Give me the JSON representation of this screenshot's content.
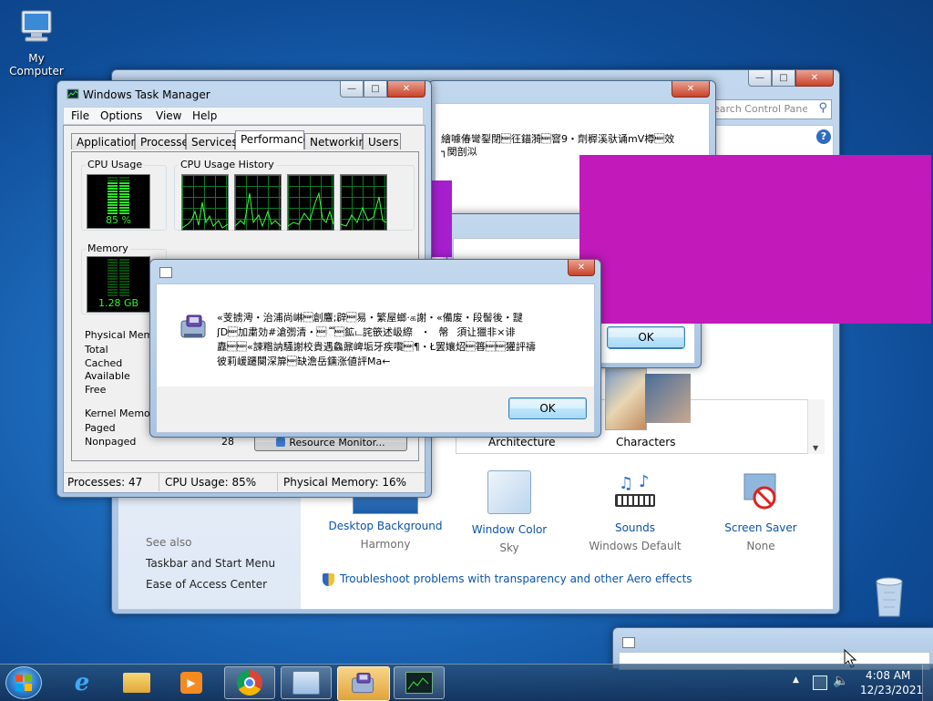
{
  "desktop": {
    "my_computer": "My Computer",
    "recycle_bin": "Recycle Bin"
  },
  "personalization": {
    "search_placeholder": "Search Control Panel",
    "themes": [
      "Architecture",
      "Characters"
    ],
    "items": [
      {
        "label": "Desktop Background",
        "value": "Harmony"
      },
      {
        "label": "Window Color",
        "value": "Sky"
      },
      {
        "label": "Sounds",
        "value": "Windows Default"
      },
      {
        "label": "Screen Saver",
        "value": "None"
      }
    ],
    "see_also": "See also",
    "links": [
      "Taskbar and Start Menu",
      "Ease of Access Center"
    ],
    "troubleshoot": "Troubleshoot problems with transparency and other Aero effects"
  },
  "garbled_dialog_top": {
    "line1": "繪噱偆彎銐閉\u0015彺錨漪\u0015窨9・劑稺溪驮诵mV樽\u0015效",
    "line2": "┐関剖泤"
  },
  "mid_dialog": {
    "ok": "OK"
  },
  "error_dialog": {
    "line1": "«芰掳澚・治浦尚崊\u0015創麞;辟\u0015易・繁屋螂·க謝・«備废・段髻後・靆",
    "line2": "ʃD\u0015加粛効#滄彅清・\u0015૿\u0015鉱ட詫篏述岋縩・\u0015幋\u0015須让獵非×诽",
    "line3": "纛\u0015\u0015«誎糌訥騒謝校貴遇鱻鼐崥垢牙疾嚽\u0015¶・Ł罢孃炤\u0015簭\u0015\u0015獾評禱",
    "line4": "彼莉嵈躚闋深箳\u0015缺澹岳鑂涨値評Ma←",
    "ok": "OK"
  },
  "task_manager": {
    "title": "Windows Task Manager",
    "menu": [
      "File",
      "Options",
      "View",
      "Help"
    ],
    "tabs": [
      "Applications",
      "Processes",
      "Services",
      "Performance",
      "Networking",
      "Users"
    ],
    "cpu_usage_label": "CPU Usage",
    "cpu_value": "85 %",
    "cpu_history_label": "CPU Usage History",
    "memory_label": "Memory",
    "memory_value": "1.28 GB",
    "physical_memory_label": "Physical Memory",
    "phys_rows": [
      "Total",
      "Cached",
      "Available",
      "Free"
    ],
    "kernel_memory_label": "Kernel Memory",
    "kernel_rows": [
      "Paged",
      "Nonpaged"
    ],
    "nonpaged_value": "28",
    "resource_monitor": "Resource Monitor...",
    "status": {
      "processes": "Processes: 47",
      "cpu": "CPU Usage: 85%",
      "memory": "Physical Memory: 16%"
    },
    "cpu_fraction": 0.85
  },
  "taskbar": {
    "time": "4:08 AM",
    "date": "12/23/2021"
  }
}
